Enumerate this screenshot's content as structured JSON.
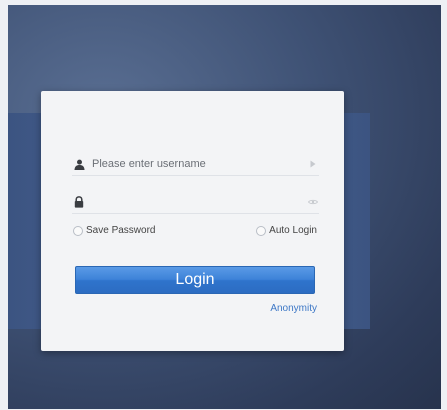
{
  "login": {
    "username_placeholder": "Please enter username",
    "password_placeholder": "",
    "save_password_label": "Save Password",
    "auto_login_label": "Auto Login",
    "login_button_label": "Login",
    "anonymity_link": "Anonymity"
  },
  "icons": {
    "username": "user-icon",
    "password": "lock-icon",
    "username_trail": "arrow-right-icon",
    "password_trail": "eye-icon"
  },
  "colors": {
    "accent": "#3d82d8",
    "link": "#3e78c6",
    "background": "#3f5275"
  }
}
